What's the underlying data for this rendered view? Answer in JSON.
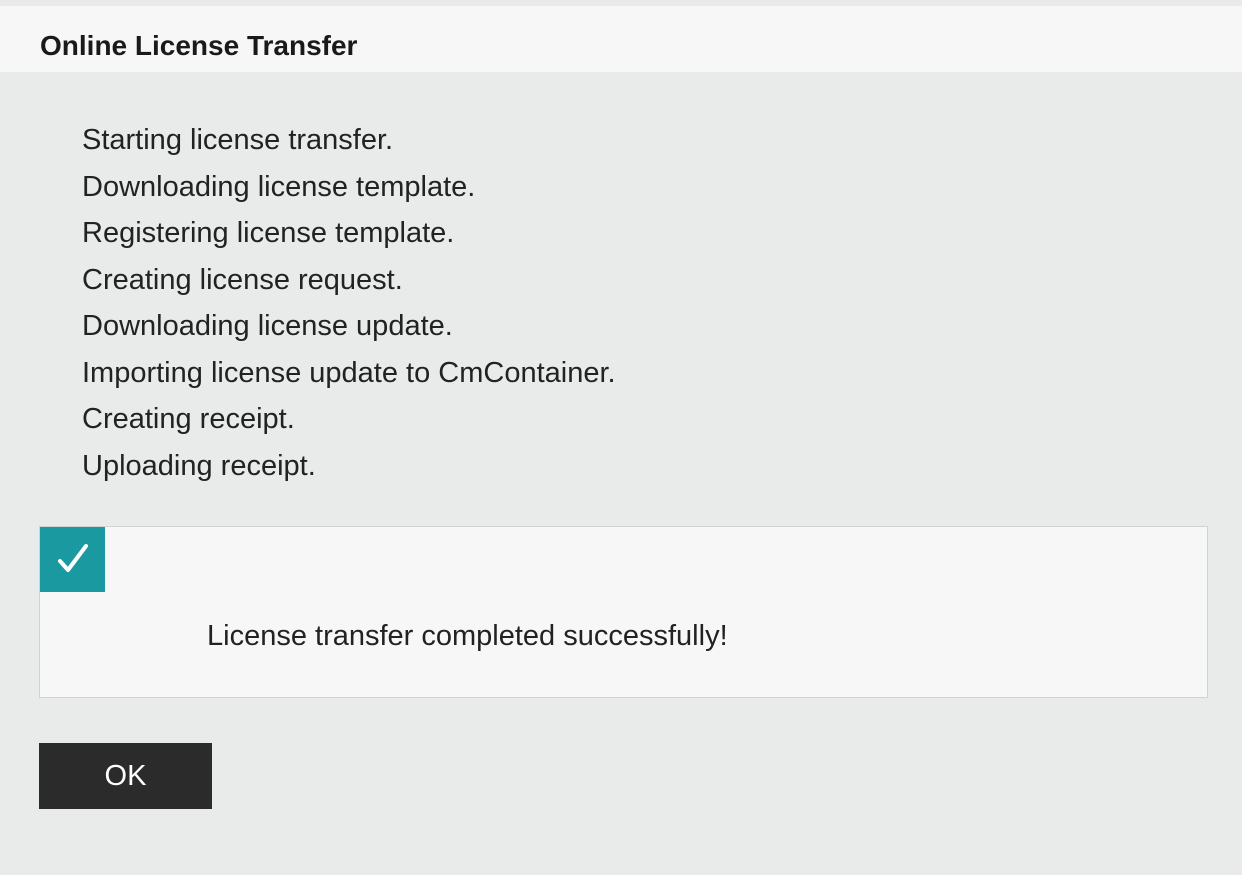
{
  "dialog": {
    "title": "Online License Transfer"
  },
  "log": {
    "lines": [
      "Starting license transfer.",
      "Downloading license template.",
      "Registering license template.",
      "Creating license request.",
      "Downloading license update.",
      "Importing license update to CmContainer.",
      "Creating receipt.",
      "Uploading receipt."
    ]
  },
  "result": {
    "icon": "checkmark-icon",
    "status_color": "#1a9aa0",
    "message": "License transfer completed successfully!"
  },
  "actions": {
    "ok_label": "OK"
  }
}
